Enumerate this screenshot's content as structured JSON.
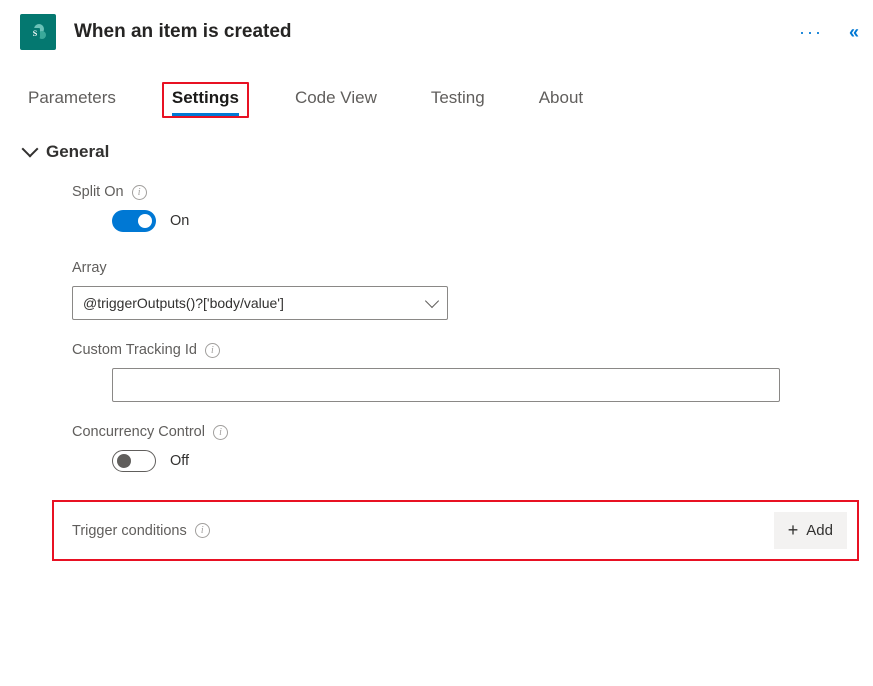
{
  "header": {
    "title": "When an item is created",
    "icon_name": "sharepoint-icon"
  },
  "tabs": [
    {
      "label": "Parameters",
      "active": false
    },
    {
      "label": "Settings",
      "active": true
    },
    {
      "label": "Code View",
      "active": false
    },
    {
      "label": "Testing",
      "active": false
    },
    {
      "label": "About",
      "active": false
    }
  ],
  "section": {
    "title": "General",
    "split_on": {
      "label": "Split On",
      "state_label": "On",
      "on": true
    },
    "array": {
      "label": "Array",
      "value": "@triggerOutputs()?['body/value']"
    },
    "custom_tracking": {
      "label": "Custom Tracking Id",
      "value": ""
    },
    "concurrency": {
      "label": "Concurrency Control",
      "state_label": "Off",
      "on": false
    },
    "trigger_conditions": {
      "label": "Trigger conditions",
      "add_label": "Add"
    }
  }
}
